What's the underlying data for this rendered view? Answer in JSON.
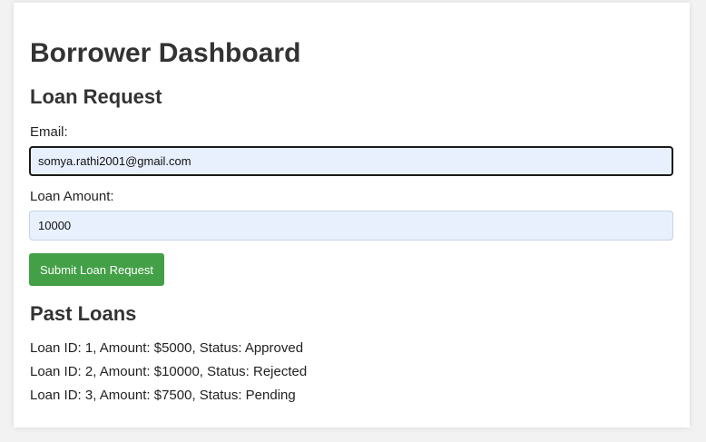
{
  "page": {
    "title": "Borrower Dashboard"
  },
  "loan_request": {
    "heading": "Loan Request",
    "email_label": "Email:",
    "email_value": "somya.rathi2001@gmail.com",
    "amount_label": "Loan Amount:",
    "amount_value": "10000",
    "submit_label": "Submit Loan Request"
  },
  "past_loans": {
    "heading": "Past Loans",
    "items": [
      "Loan ID: 1, Amount: $5000, Status: Approved",
      "Loan ID: 2, Amount: $10000, Status: Rejected",
      "Loan ID: 3, Amount: $7500, Status: Pending"
    ]
  },
  "colors": {
    "submit_button": "#43a047",
    "input_background": "#e8f0fe"
  }
}
